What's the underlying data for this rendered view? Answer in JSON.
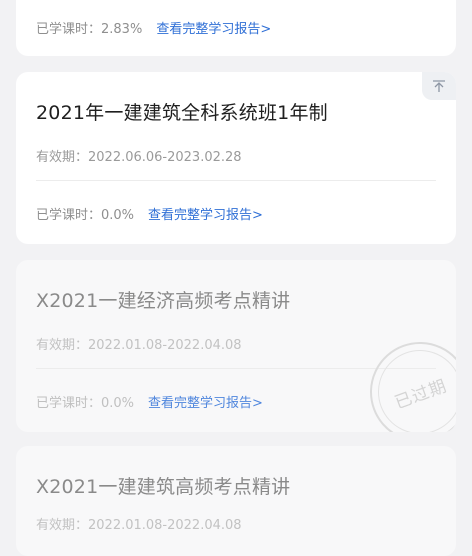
{
  "cards": [
    {
      "progress_label": "已学课时：2.83%",
      "report_link": "查看完整学习报告>"
    },
    {
      "title": "2021年一建建筑全科系统班1年制",
      "validity": "有效期：2022.06.06-2023.02.28",
      "progress_label": "已学课时：0.0%",
      "report_link": "查看完整学习报告>",
      "pin_icon": "pin-to-top-icon"
    },
    {
      "title": "X2021一建经济高频考点精讲",
      "validity": "有效期：2022.01.08-2022.04.08",
      "progress_label": "已学课时：0.0%",
      "report_link": "查看完整学习报告>",
      "stamp": "已过期"
    },
    {
      "title": "X2021一建建筑高频考点精讲",
      "validity": "有效期：2022.01.08-2022.04.08"
    }
  ],
  "colors": {
    "background": "#f2f2f4",
    "link": "#2f6fd6"
  }
}
